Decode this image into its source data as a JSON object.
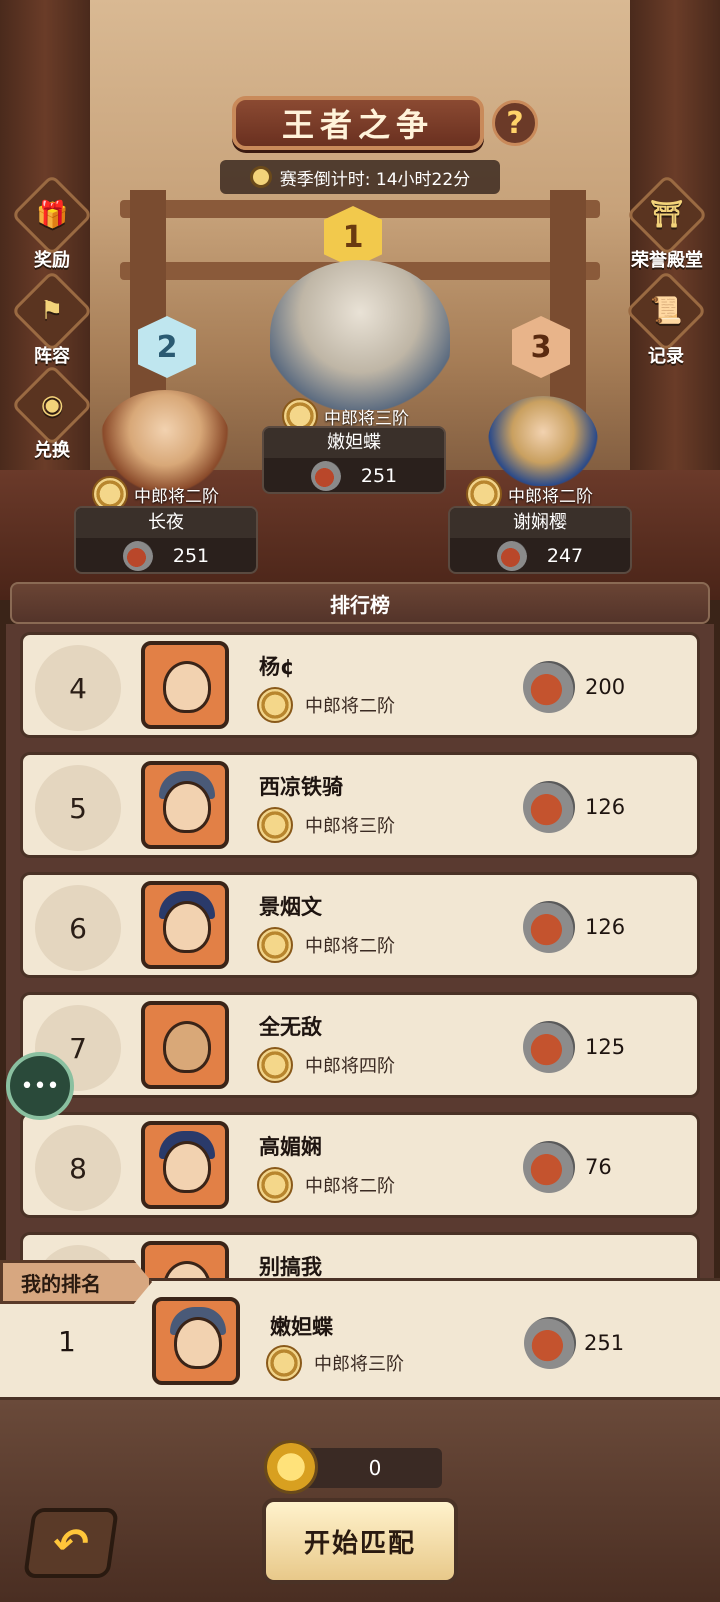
{
  "header": {
    "title": "王者之争",
    "help": "?",
    "season_label": "赛季倒计时: 14小时22分"
  },
  "side_buttons": {
    "left": [
      {
        "label": "奖励",
        "icon": "gift-icon"
      },
      {
        "label": "阵容",
        "icon": "flag-icon"
      },
      {
        "label": "兑换",
        "icon": "coin-exchange-icon"
      }
    ],
    "right": [
      {
        "label": "荣誉殿堂",
        "icon": "temple-icon"
      },
      {
        "label": "记录",
        "icon": "scroll-icon"
      }
    ]
  },
  "podium": [
    {
      "rank": "1",
      "tier": "中郎将三阶",
      "name": "嫩妲蝶",
      "score": "251"
    },
    {
      "rank": "2",
      "tier": "中郎将二阶",
      "name": "长夜",
      "score": "251"
    },
    {
      "rank": "3",
      "tier": "中郎将二阶",
      "name": "谢娴樱",
      "score": "247"
    }
  ],
  "leaderboard": {
    "title": "排行榜",
    "rows": [
      {
        "rank": "4",
        "name": "杨¢",
        "tier": "中郎将二阶",
        "score": "200"
      },
      {
        "rank": "5",
        "name": "西凉铁骑",
        "tier": "中郎将三阶",
        "score": "126"
      },
      {
        "rank": "6",
        "name": "景烟文",
        "tier": "中郎将二阶",
        "score": "126"
      },
      {
        "rank": "7",
        "name": "全无敌",
        "tier": "中郎将四阶",
        "score": "125"
      },
      {
        "rank": "8",
        "name": "高媚娴",
        "tier": "中郎将二阶",
        "score": "76"
      },
      {
        "rank": "",
        "name": "别搞我",
        "tier": "",
        "score": ""
      }
    ]
  },
  "my_rank": {
    "label": "我的排名",
    "rank": "1",
    "name": "嫩妲蝶",
    "tier": "中郎将三阶",
    "score": "251"
  },
  "footer": {
    "coins": "0",
    "start_label": "开始匹配",
    "back_icon": "back-arrow-icon"
  },
  "colors": {
    "panel_bg": "#f2e7d3",
    "header_brown": "#6a4434",
    "gold": "#f3d37a"
  }
}
